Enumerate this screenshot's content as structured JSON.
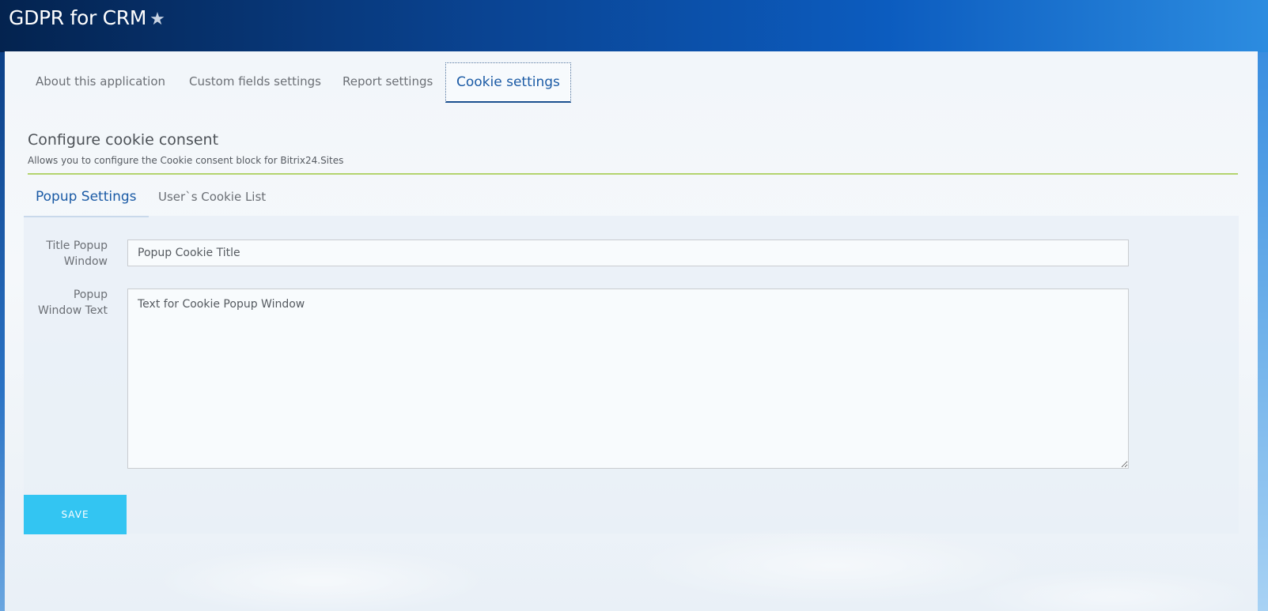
{
  "header": {
    "app_title": "GDPR for CRM",
    "favorite_glyph": "★"
  },
  "top_tabs": [
    {
      "label": "About this application",
      "active": false
    },
    {
      "label": "Custom fields settings",
      "active": false
    },
    {
      "label": "Report settings",
      "active": false
    },
    {
      "label": "Cookie settings",
      "active": true
    }
  ],
  "section": {
    "title": "Configure cookie consent",
    "description": "Allows you to configure the Cookie consent block for Bitrix24.Sites"
  },
  "sub_tabs": [
    {
      "label": "Popup Settings",
      "active": true
    },
    {
      "label": "User`s Cookie List",
      "active": false
    }
  ],
  "form": {
    "title_popup": {
      "label_line1": "Title Popup",
      "label_line2": "Window",
      "value": "Popup Cookie Title"
    },
    "popup_text": {
      "label_line1": "Popup",
      "label_line2": "Window Text",
      "value": "Text for Cookie Popup Window"
    },
    "save_label": "SAVE"
  },
  "colors": {
    "accent_blue": "#1a5aa5",
    "save_button": "#33c5f2",
    "divider_green": "#b4d46e"
  },
  "icons": {
    "favorite": "star-icon"
  }
}
